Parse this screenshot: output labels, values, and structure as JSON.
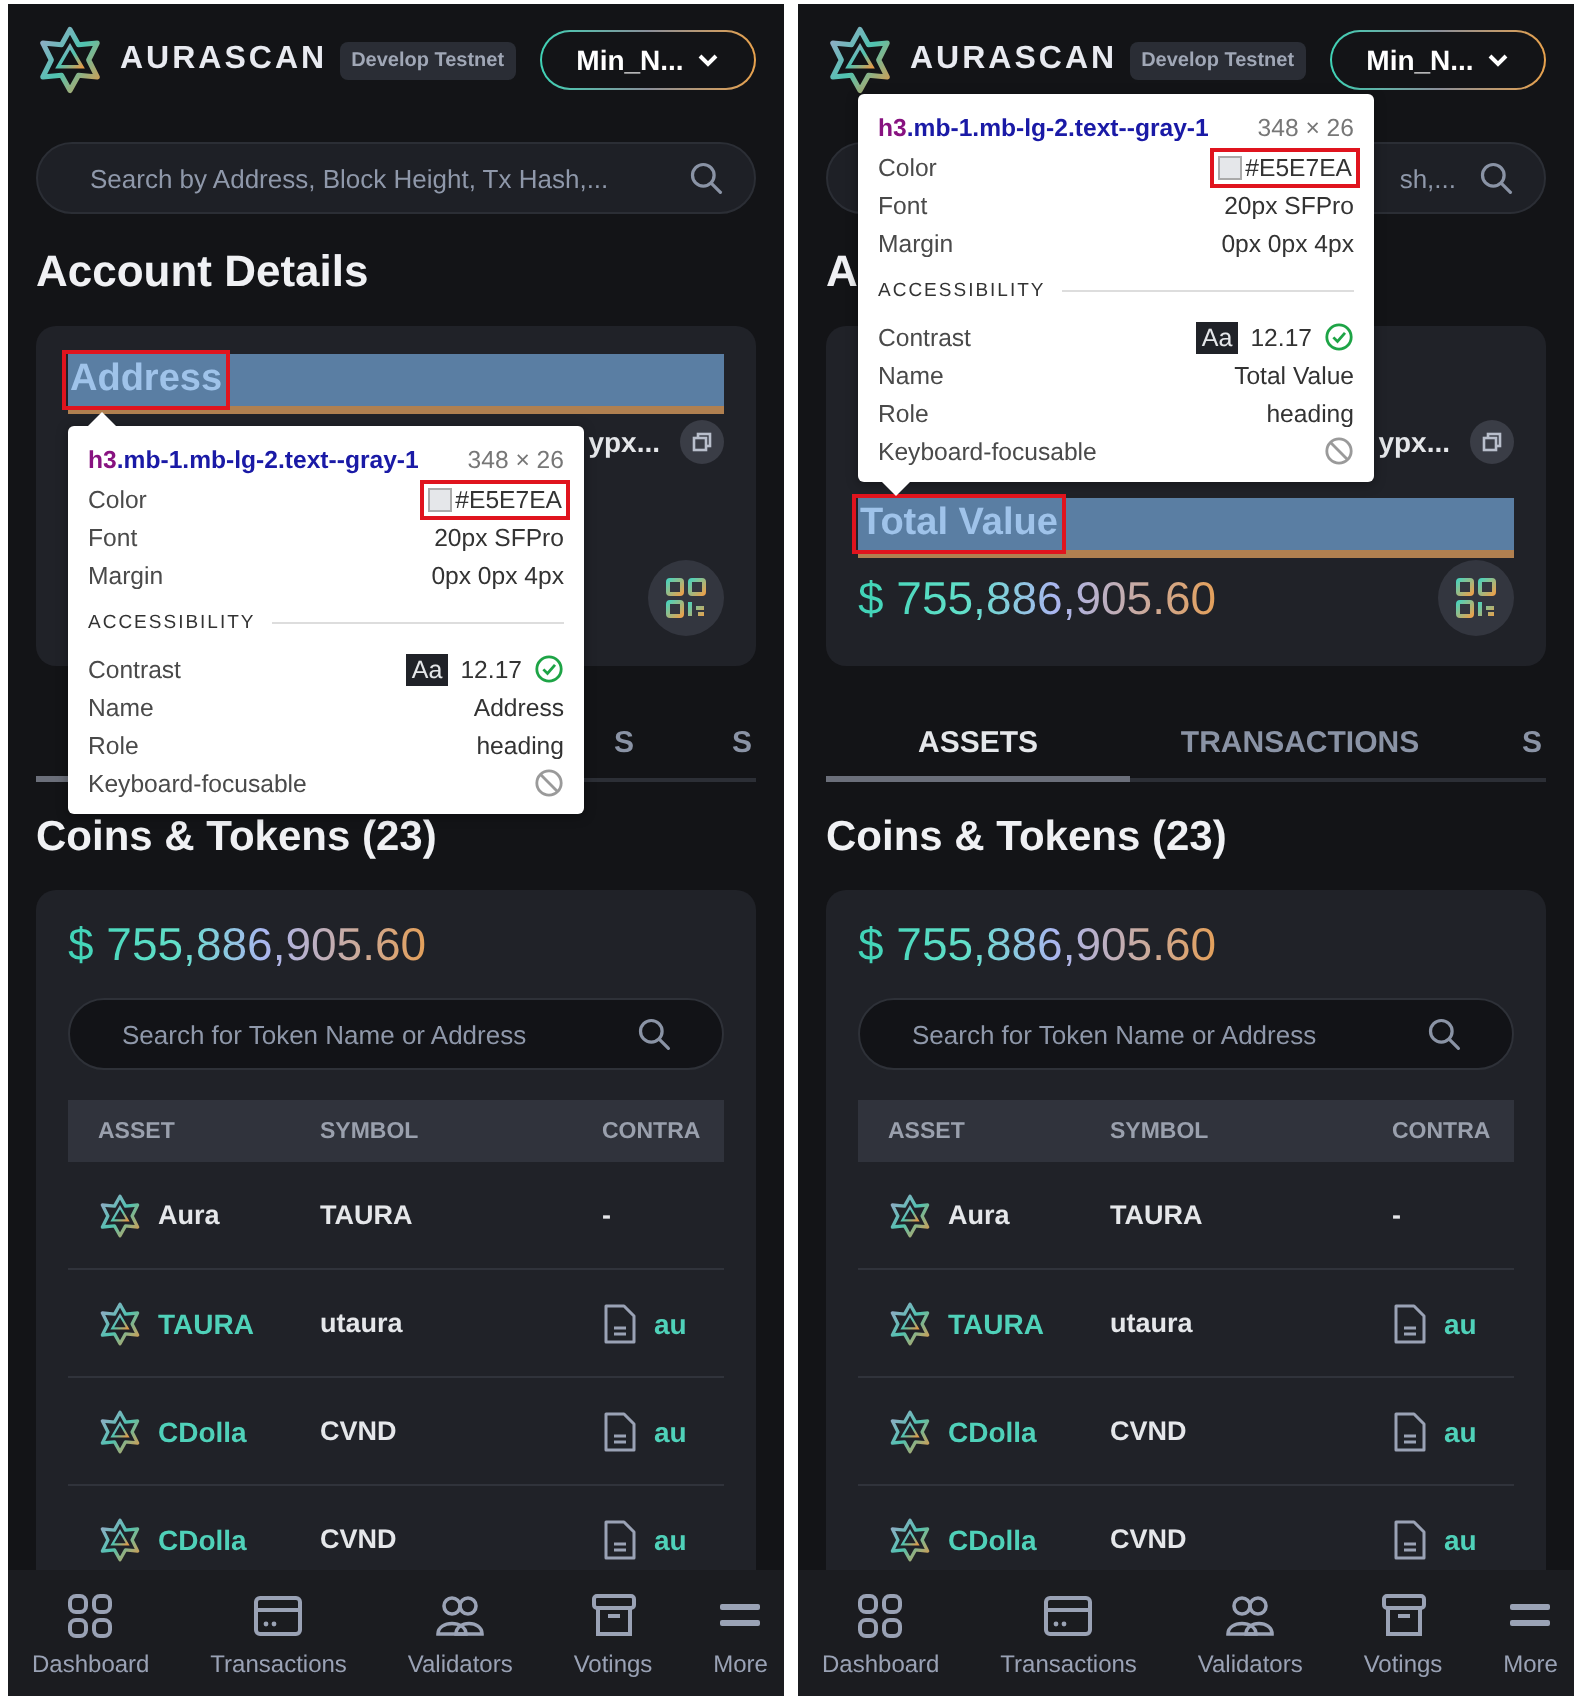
{
  "screens": [
    {
      "header": {
        "brand": "AURASCAN",
        "network": "Develop Testnet",
        "account": "Min_N..."
      },
      "search": {
        "placeholder": "Search by Address, Block Height, Tx Hash,..."
      },
      "page_title": "Account Details",
      "account_card": {
        "address_heading": {
          "text": "Address",
          "inspected": true,
          "annotated": true
        },
        "address": "ypx..."
      },
      "tooltip": {
        "tag": "h3",
        "classes": ".mb-1.mb-lg-2.text--gray-1",
        "size": "348 × 26",
        "rows": [
          {
            "label": "Color",
            "value": "#E5E7EA",
            "kind": "color",
            "annotated": true
          },
          {
            "label": "Font",
            "value": "20px SFPro",
            "kind": "text"
          },
          {
            "label": "Margin",
            "value": "0px 0px 4px",
            "kind": "text"
          }
        ],
        "section": "ACCESSIBILITY",
        "a11y_rows": [
          {
            "label": "Contrast",
            "kind": "contrast",
            "badge": "Aa",
            "value": "12.17",
            "passes": true
          },
          {
            "label": "Name",
            "kind": "text",
            "value": "Address"
          },
          {
            "label": "Role",
            "kind": "text",
            "value": "heading"
          },
          {
            "label": "Keyboard-focusable",
            "kind": "focusable",
            "focusable": false
          }
        ]
      },
      "tabs": [
        {
          "selected": true
        },
        {
          "label": "S",
          "selected": false,
          "partly_hidden": true
        },
        {
          "label": "S",
          "selected": false
        }
      ],
      "coins": {
        "title": "Coins & Tokens (23)",
        "total": "$ 755,886,905.60",
        "search_placeholder": "Search for Token Name or Address",
        "columns": [
          "ASSET",
          "SYMBOL",
          "CONTRA"
        ],
        "rows": [
          {
            "asset": "Aura",
            "link": false,
            "symbol": "TAURA",
            "contract": "-",
            "kind": "none"
          },
          {
            "asset": "TAURA",
            "link": true,
            "symbol": "utaura",
            "contract": "au",
            "kind": "contract"
          },
          {
            "asset": "CDolla",
            "link": true,
            "symbol": "CVND",
            "contract": "au",
            "kind": "contract"
          },
          {
            "asset": "CDolla",
            "link": true,
            "symbol": "CVND",
            "contract": "au",
            "kind": "contract"
          }
        ]
      },
      "nav": [
        {
          "label": "Dashboard"
        },
        {
          "label": "Transactions"
        },
        {
          "label": "Validators"
        },
        {
          "label": "Votings"
        },
        {
          "label": "More"
        }
      ]
    },
    {
      "header": {
        "brand": "AURASCAN",
        "network": "Develop Testnet",
        "account": "Min_N..."
      },
      "search": {
        "placeholder": "sh,...",
        "partly_hidden": true
      },
      "page_title": "A",
      "account_card": {
        "address": "ypx...",
        "total_heading": {
          "text": "Total Value",
          "inspected": true,
          "annotated": true
        },
        "total_value": "$ 755,886,905.60"
      },
      "tooltip": {
        "tag": "h3",
        "classes": ".mb-1.mb-lg-2.text--gray-1",
        "size": "348 × 26",
        "rows": [
          {
            "label": "Color",
            "value": "#E5E7EA",
            "kind": "color",
            "annotated": true
          },
          {
            "label": "Font",
            "value": "20px SFPro",
            "kind": "text"
          },
          {
            "label": "Margin",
            "value": "0px 0px 4px",
            "kind": "text"
          }
        ],
        "section": "ACCESSIBILITY",
        "a11y_rows": [
          {
            "label": "Contrast",
            "kind": "contrast",
            "badge": "Aa",
            "value": "12.17",
            "passes": true
          },
          {
            "label": "Name",
            "kind": "text",
            "value": "Total Value"
          },
          {
            "label": "Role",
            "kind": "text",
            "value": "heading"
          },
          {
            "label": "Keyboard-focusable",
            "kind": "focusable",
            "focusable": false
          }
        ]
      },
      "tabs": [
        {
          "label": "ASSETS",
          "selected": true
        },
        {
          "label": "TRANSACTIONS",
          "selected": false
        },
        {
          "label": "S",
          "selected": false
        }
      ],
      "coins": {
        "title": "Coins & Tokens (23)",
        "total": "$ 755,886,905.60",
        "search_placeholder": "Search for Token Name or Address",
        "columns": [
          "ASSET",
          "SYMBOL",
          "CONTRA"
        ],
        "rows": [
          {
            "asset": "Aura",
            "link": false,
            "symbol": "TAURA",
            "contract": "-",
            "kind": "none"
          },
          {
            "asset": "TAURA",
            "link": true,
            "symbol": "utaura",
            "contract": "au",
            "kind": "contract"
          },
          {
            "asset": "CDolla",
            "link": true,
            "symbol": "CVND",
            "contract": "au",
            "kind": "contract"
          },
          {
            "asset": "CDolla",
            "link": true,
            "symbol": "CVND",
            "contract": "au",
            "kind": "contract"
          }
        ]
      },
      "nav": [
        {
          "label": "Dashboard"
        },
        {
          "label": "Transactions"
        },
        {
          "label": "Validators"
        },
        {
          "label": "Votings"
        },
        {
          "label": "More"
        }
      ]
    }
  ]
}
